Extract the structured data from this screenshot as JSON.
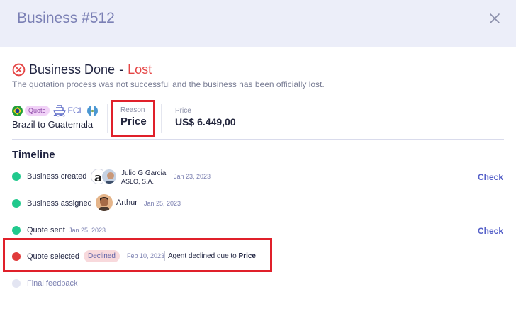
{
  "modal": {
    "title": "Business #512",
    "close_icon": "close-icon"
  },
  "status": {
    "icon": "x-circle-icon",
    "text": "Business Done",
    "separator": "-",
    "result": "Lost",
    "description": "The quotation process was not successful and the business has been officially lost."
  },
  "route": {
    "origin_flag": "brazil-flag-icon",
    "badge": "Quote",
    "transport_icon": "ship-icon",
    "mode": "FCL",
    "destination_flag": "guatemala-flag-icon",
    "text": "Brazil to Guatemala"
  },
  "reason": {
    "label": "Reason",
    "value": "Price"
  },
  "price": {
    "label": "Price",
    "value": "US$ 6.449,00"
  },
  "timeline": {
    "title": "Timeline",
    "events": [
      {
        "label": "Business created",
        "person": "Julio G Garcia",
        "company": "ASLO, S.A.",
        "date": "Jan 23, 2023",
        "action": "Check",
        "status": "done"
      },
      {
        "label": "Business assigned",
        "person": "Arthur",
        "date": "Jan 25, 2023",
        "status": "done"
      },
      {
        "label": "Quote sent",
        "date": "Jan 25, 2023",
        "action": "Check",
        "status": "done"
      },
      {
        "label": "Quote selected",
        "badge": "Declined",
        "date": "Feb 10, 2023",
        "note_prefix": "Agent declined due to",
        "note_reason": "Price",
        "status": "declined"
      },
      {
        "label": "Final feedback",
        "status": "pending"
      }
    ]
  },
  "colors": {
    "accent": "#5560c8",
    "lost": "#e54545",
    "done": "#21c98d",
    "declined": "#e03b3b",
    "header_bg": "#eceef9"
  }
}
